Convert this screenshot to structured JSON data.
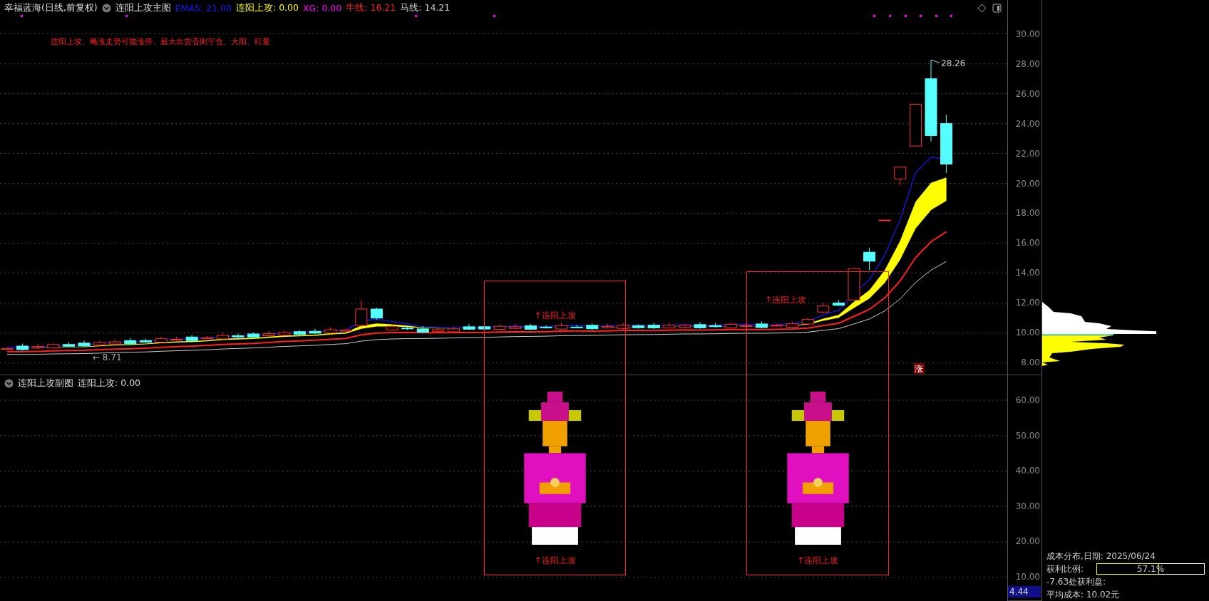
{
  "header": {
    "stock": "幸福蓝海(日线,前复权)",
    "indicator_name": "连阳上攻主图",
    "values": [
      {
        "label": "EMA5:",
        "value": "21.00",
        "color": "#1a1aff"
      },
      {
        "label": "连阳上攻:",
        "value": "0.00",
        "color": "#ffff00"
      },
      {
        "label": "XG:",
        "value": "0.00",
        "color": "#ff00ff"
      },
      {
        "label": "牛线:",
        "value": "16.21",
        "color": "#ff2020"
      },
      {
        "label": "马线:",
        "value": "14.21",
        "color": "#cccccc"
      }
    ]
  },
  "note": "连阳上攻、飚涨走势可能涨停、最大出货否则守仓、大阳、盯量",
  "main_chart": {
    "high_label": "28.26",
    "low_label": "← 8.71",
    "limit_badge": "涨",
    "axis": [
      "30.00",
      "28.00",
      "26.00",
      "24.00",
      "22.00",
      "20.00",
      "18.00",
      "16.00",
      "14.00",
      "12.00",
      "10.00",
      "8.00"
    ]
  },
  "signals": [
    {
      "top_label": "↑连阳上攻",
      "bottom_label": "↑连阳上攻"
    },
    {
      "top_label": "↑连阳上攻",
      "bottom_label": "↑连阳上攻"
    }
  ],
  "sub_chart": {
    "title": "连阳上攻副图",
    "value_label": "连阳上攻:",
    "value": "0.00",
    "axis": [
      "60.00",
      "50.00",
      "40.00",
      "30.00",
      "20.00",
      "10.00"
    ],
    "cursor_value": "4.44"
  },
  "cost_panel": {
    "title": "成本分布,日期:",
    "date": "2025/06/24",
    "profit_label": "获利比例:",
    "profit_ratio": "57.1%",
    "level": 0.571,
    "profit_line": "-7.63处获利盘:",
    "avg_label": "平均成本:",
    "avg_value": "10.02元"
  }
}
